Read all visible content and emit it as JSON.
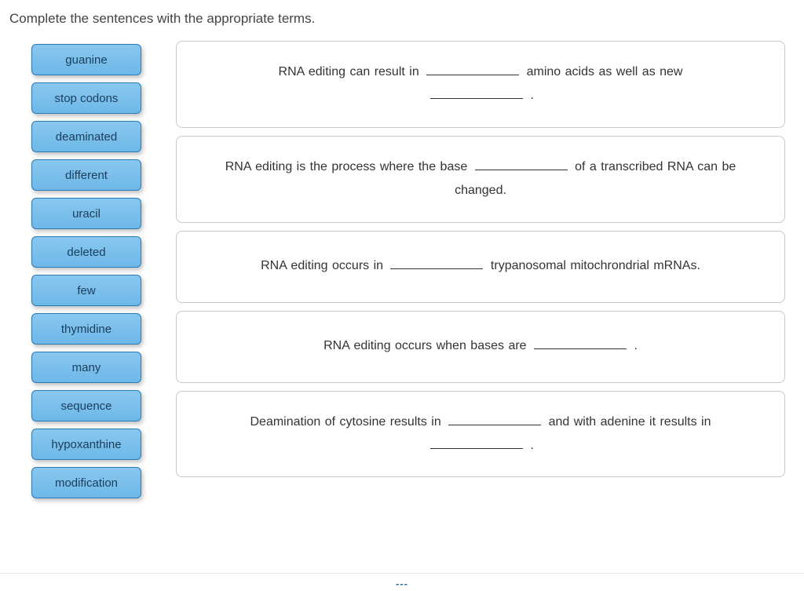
{
  "instruction": "Complete the sentences with the appropriate terms.",
  "terms": [
    "guanine",
    "stop codons",
    "deaminated",
    "different",
    "uracil",
    "deleted",
    "few",
    "thymidine",
    "many",
    "sequence",
    "hypoxanthine",
    "modification"
  ],
  "sentences": {
    "s1_a": "RNA editing can result in ",
    "s1_b": " amino acids as well as new ",
    "s1_c": " .",
    "s2_a": "RNA editing is the process where the base ",
    "s2_b": " of a transcribed RNA can be changed.",
    "s3_a": "RNA editing occurs in ",
    "s3_b": " trypanosomal mitochrondrial mRNAs.",
    "s4_a": "RNA editing occurs when bases are ",
    "s4_b": " .",
    "s5_a": "Deamination of cytosine results in ",
    "s5_b": " and with adenine it results in ",
    "s5_c": " ."
  }
}
